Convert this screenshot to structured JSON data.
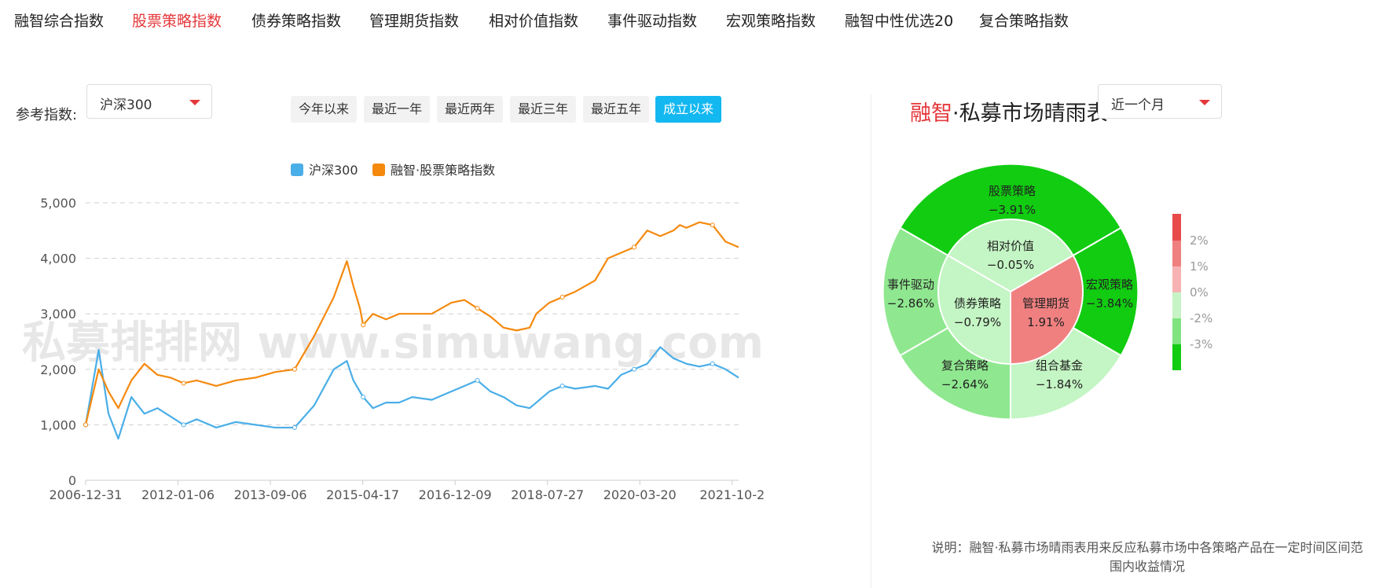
{
  "nav": [
    {
      "label": "融智综合指数",
      "active": false
    },
    {
      "label": "股票策略指数",
      "active": true
    },
    {
      "label": "债券策略指数",
      "active": false
    },
    {
      "label": "管理期货指数",
      "active": false
    },
    {
      "label": "相对价值指数",
      "active": false
    },
    {
      "label": "事件驱动指数",
      "active": false
    },
    {
      "label": "宏观策略指数",
      "active": false
    },
    {
      "label": "融智中性优选20",
      "active": false
    },
    {
      "label": "复合策略指数",
      "active": false
    }
  ],
  "controls": {
    "ref_label": "参考指数:",
    "ref_select_value": "沪深300",
    "range_buttons": [
      {
        "label": "今年以来",
        "active": false
      },
      {
        "label": "最近一年",
        "active": false
      },
      {
        "label": "最近两年",
        "active": false
      },
      {
        "label": "最近三年",
        "active": false
      },
      {
        "label": "最近五年",
        "active": false
      },
      {
        "label": "成立以来",
        "active": true
      }
    ]
  },
  "right": {
    "title_brand": "融智",
    "title_rest": "·私募市场晴雨表",
    "period_select_value": "近一个月",
    "note": "说明：融智·私募市场晴雨表用来反应私募市场中各策略产品在一定时间区间范围内收益情况"
  },
  "colors": {
    "hs300": "#4aaee8",
    "stock_index": "#f5890e",
    "accent_red": "#e5383b",
    "active_btn": "#14b8f0"
  },
  "chart_data": [
    {
      "type": "line",
      "watermark": "私募排排网 www.simuwang.com",
      "legend": [
        "沪深300",
        "融智·股票策略指数"
      ],
      "y_ticks": [
        "0",
        "1,000",
        "2,000",
        "3,000",
        "4,000",
        "5,000"
      ],
      "ylim": [
        0,
        5000
      ],
      "x_ticks": [
        "2006-12-31",
        "2012-01-06",
        "2013-09-06",
        "2015-04-17",
        "2016-12-09",
        "2018-07-27",
        "2020-03-20",
        "2021-10-2"
      ],
      "x": [
        0,
        0.02,
        0.035,
        0.05,
        0.07,
        0.09,
        0.11,
        0.13,
        0.15,
        0.17,
        0.2,
        0.23,
        0.26,
        0.29,
        0.32,
        0.35,
        0.38,
        0.4,
        0.41,
        0.42,
        0.425,
        0.44,
        0.46,
        0.48,
        0.5,
        0.53,
        0.56,
        0.58,
        0.6,
        0.62,
        0.64,
        0.66,
        0.68,
        0.69,
        0.71,
        0.73,
        0.75,
        0.78,
        0.8,
        0.82,
        0.84,
        0.86,
        0.88,
        0.9,
        0.91,
        0.92,
        0.94,
        0.96,
        0.98,
        1.0
      ],
      "series": [
        {
          "name": "沪深300",
          "values": [
            1000,
            2350,
            1200,
            750,
            1500,
            1200,
            1300,
            1150,
            1000,
            1100,
            950,
            1050,
            1000,
            950,
            950,
            1350,
            2000,
            2150,
            1800,
            1600,
            1500,
            1300,
            1400,
            1400,
            1500,
            1450,
            1600,
            1700,
            1800,
            1600,
            1500,
            1350,
            1300,
            1400,
            1600,
            1700,
            1650,
            1700,
            1650,
            1900,
            2000,
            2100,
            2400,
            2200,
            2150,
            2100,
            2050,
            2100,
            2000,
            1850
          ]
        },
        {
          "name": "融智·股票策略指数",
          "values": [
            1000,
            2000,
            1600,
            1300,
            1800,
            2100,
            1900,
            1850,
            1750,
            1800,
            1700,
            1800,
            1850,
            1950,
            2000,
            2600,
            3300,
            3950,
            3500,
            3100,
            2800,
            3000,
            2900,
            3000,
            3000,
            3000,
            3200,
            3250,
            3100,
            2950,
            2750,
            2700,
            2750,
            3000,
            3200,
            3300,
            3400,
            3600,
            4000,
            4100,
            4200,
            4500,
            4400,
            4500,
            4600,
            4550,
            4650,
            4600,
            4300,
            4200
          ]
        }
      ]
    },
    {
      "type": "pie",
      "scale_ticks": [
        "2%",
        "1%",
        "0%",
        "-2%",
        "-3%"
      ],
      "outer": [
        {
          "label": "股票策略",
          "value": "−3.91%"
        },
        {
          "label": "宏观策略",
          "value": "−3.84%"
        },
        {
          "label": "组合基金",
          "value": "−1.84%"
        },
        {
          "label": "复合策略",
          "value": "−2.64%"
        },
        {
          "label": "事件驱动",
          "value": "−2.86%"
        }
      ],
      "inner": [
        {
          "label": "相对价值",
          "value": "−0.05%"
        },
        {
          "label": "管理期货",
          "value": "1.91%"
        },
        {
          "label": "债券策略",
          "value": "−0.79%"
        }
      ]
    }
  ]
}
